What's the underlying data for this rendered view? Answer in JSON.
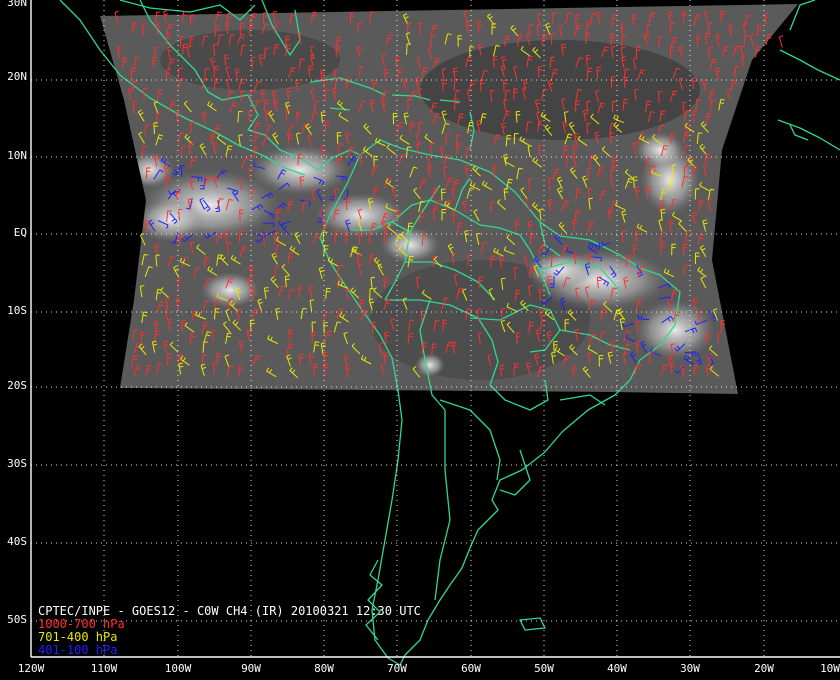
{
  "map": {
    "caption": "CPTEC/INPE - GOES12 - C0W CH4 (IR) 20100321 12:30 UTC",
    "legend": [
      {
        "label": "1000-700 hPa",
        "color": "#ff3030"
      },
      {
        "label": "701-400 hPa",
        "color": "#e8e800"
      },
      {
        "label": "401-100 hPa",
        "color": "#2020ff"
      }
    ],
    "latitude_labels": [
      "30N",
      "20N",
      "10N",
      "EQ",
      "10S",
      "20S",
      "30S",
      "40S",
      "50S"
    ],
    "longitude_labels": [
      "120W",
      "110W",
      "100W",
      "90W",
      "80W",
      "70W",
      "60W",
      "50W",
      "40W",
      "30W",
      "20W",
      "10W"
    ],
    "colors": {
      "background": "#000000",
      "coastline": "#30d890",
      "grid": "#ffffff",
      "imagery": "#5a5a5a",
      "frame": "#ffffff"
    }
  }
}
